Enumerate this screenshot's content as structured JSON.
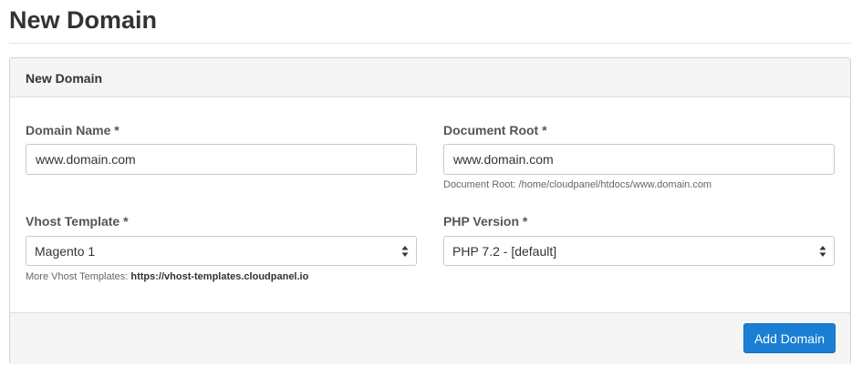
{
  "page": {
    "title": "New Domain"
  },
  "panel": {
    "title": "New Domain",
    "domain_name": {
      "label": "Domain Name *",
      "value": "www.domain.com"
    },
    "document_root": {
      "label": "Document Root *",
      "value": "www.domain.com",
      "help": "Document Root: /home/cloudpanel/htdocs/www.domain.com"
    },
    "vhost_template": {
      "label": "Vhost Template *",
      "selected": "Magento 1",
      "help_prefix": "More Vhost Templates: ",
      "help_link": "https://vhost-templates.cloudpanel.io"
    },
    "php_version": {
      "label": "PHP Version *",
      "selected": "PHP 7.2 - [default]"
    },
    "submit_label": "Add Domain"
  },
  "icons": {
    "select_arrow": "updown-caret-icon"
  },
  "colors": {
    "primary_button": "#1a7fd4",
    "panel_header_bg": "#f5f5f5"
  }
}
